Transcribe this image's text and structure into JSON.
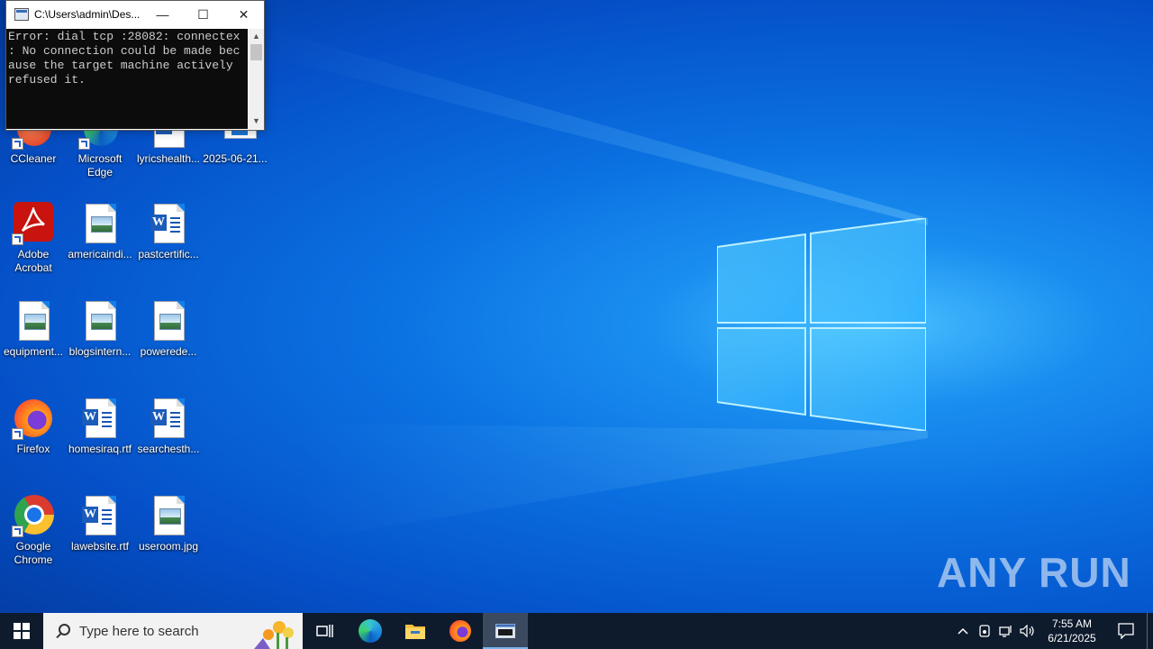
{
  "console_window": {
    "title": "C:\\Users\\admin\\Des...",
    "output": "Error: dial tcp :28082: connectex\n: No connection could be made bec\nause the target machine actively\nrefused it.",
    "minimize_glyph": "—",
    "maximize_glyph": "☐",
    "close_glyph": "✕"
  },
  "desktop_icons": {
    "ccleaner": "CCleaner",
    "edge": "Microsoft Edge",
    "lyrics": "lyricshealth...",
    "screenshot": "2025-06-21...",
    "acrobat": "Adobe Acrobat",
    "americaindi": "americaindi...",
    "pastcertific": "pastcertific...",
    "equipment": "equipment...",
    "blogsintern": "blogsintern...",
    "powerede": "powerede...",
    "firefox": "Firefox",
    "homesiraq": "homesiraq.rtf",
    "searchesth": "searchesth...",
    "chrome": "Google Chrome",
    "lawebsite": "lawebsite.rtf",
    "useroom": "useroom.jpg"
  },
  "taskbar": {
    "search_placeholder": "Type here to search",
    "time": "7:55 AM",
    "date": "6/21/2025"
  },
  "watermark": "ANY RUN",
  "colors": {
    "taskbar_bg": "#0e1b2d",
    "wallpaper_accent": "#1a8ff0"
  }
}
